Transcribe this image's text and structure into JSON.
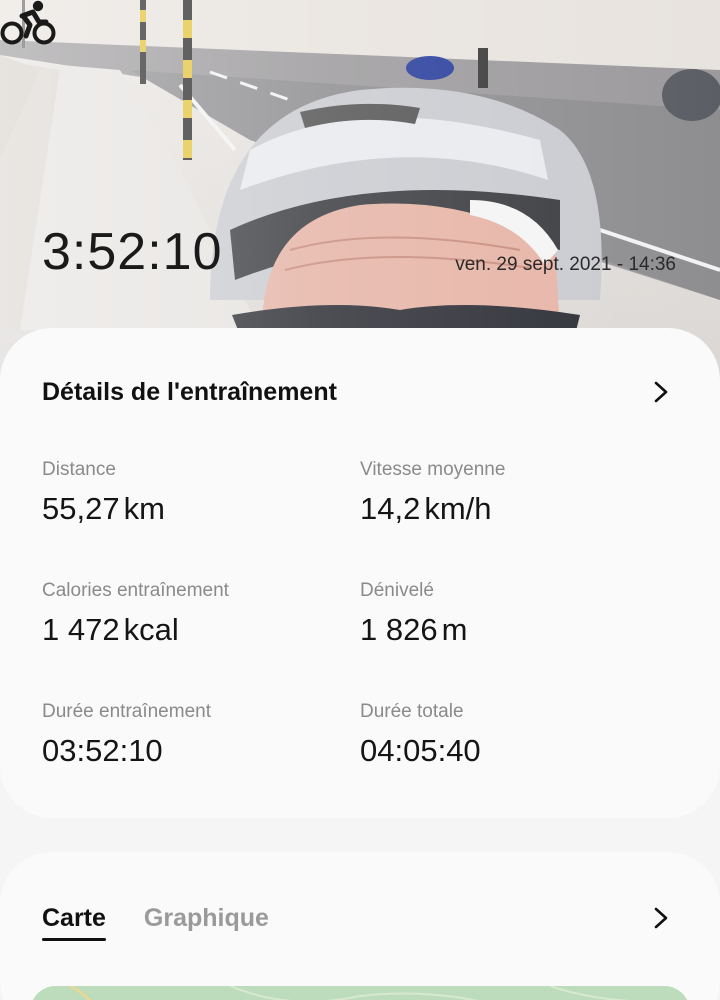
{
  "header": {
    "activity_icon": "cycling-icon",
    "duration": "3:52:10",
    "date": "ven. 29 sept. 2021 - 14:36"
  },
  "details": {
    "title": "Détails de l'entraînement",
    "chevron_icon": "chevron-right-icon",
    "stats": [
      {
        "label": "Distance",
        "value": "55,27",
        "unit": "km"
      },
      {
        "label": "Vitesse moyenne",
        "value": "14,2",
        "unit": "km/h"
      },
      {
        "label": "Calories entraînement",
        "value": "1 472",
        "unit": "kcal"
      },
      {
        "label": "Dénivelé",
        "value": "1 826",
        "unit": "m"
      },
      {
        "label": "Durée entraînement",
        "value": "03:52:10",
        "unit": ""
      },
      {
        "label": "Durée totale",
        "value": "04:05:40",
        "unit": ""
      }
    ]
  },
  "map_section": {
    "tabs": [
      {
        "label": "Carte",
        "active": true
      },
      {
        "label": "Graphique",
        "active": false
      }
    ],
    "chevron_icon": "chevron-right-icon"
  },
  "colors": {
    "card_background": "#fafafa",
    "page_background": "#f5f5f5",
    "label_gray": "#8a8a8a",
    "map_green": "#bcdcbc"
  }
}
